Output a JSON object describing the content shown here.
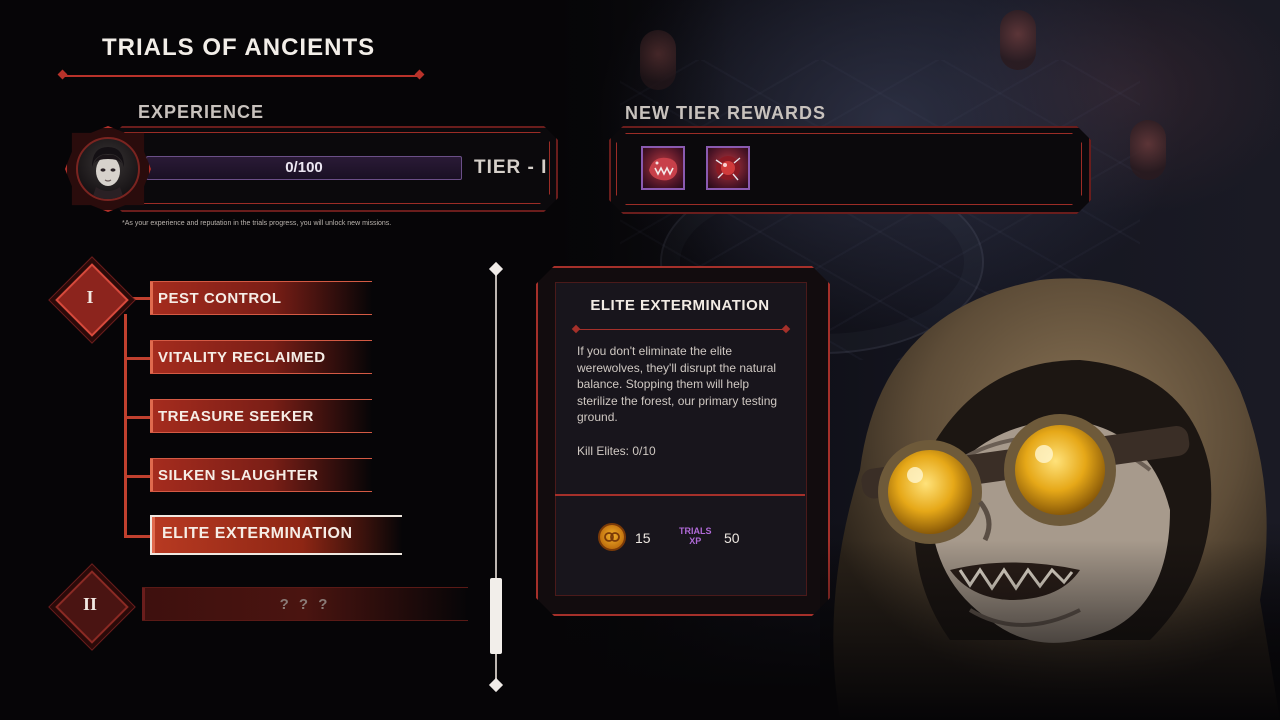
{
  "title": "TRIALS OF ANCIENTS",
  "experience": {
    "heading": "EXPERIENCE",
    "progress_text": "0/100",
    "progress_fraction": 0,
    "tier_label": "TIER - I",
    "note": "*As your experience and reputation in the trials progress, you will unlock new missions."
  },
  "rewards": {
    "heading": "NEW TIER REWARDS",
    "items": [
      {
        "icon": "werewolf-maw-icon"
      },
      {
        "icon": "crimson-orb-icon"
      }
    ]
  },
  "tiers": [
    {
      "numeral": "I",
      "missions": [
        {
          "label": "PEST CONTROL"
        },
        {
          "label": "VITALITY RECLAIMED"
        },
        {
          "label": "TREASURE SEEKER"
        },
        {
          "label": "SILKEN SLAUGHTER"
        },
        {
          "label": "ELITE EXTERMINATION",
          "selected": true
        }
      ]
    },
    {
      "numeral": "II",
      "missions": [
        {
          "label": "? ? ?",
          "locked": true
        }
      ]
    }
  ],
  "detail": {
    "title": "ELITE EXTERMINATION",
    "description": "If you don't eliminate the elite werewolves, they'll disrupt the natural balance. Stopping them will help sterilize the forest, our primary testing ground.",
    "objective": "Kill Elites: 0/10",
    "reward_gold": "15",
    "xp_label_line1": "TRIALS",
    "xp_label_line2": "XP",
    "reward_xp": "50"
  },
  "colors": {
    "accent_red": "#b8322a",
    "xp_purple": "#8a4fc0",
    "gold": "#f2b02a"
  }
}
